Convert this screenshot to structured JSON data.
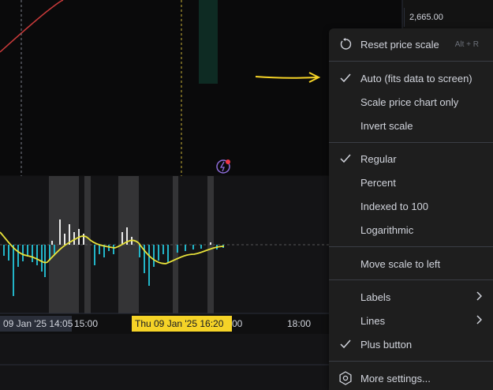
{
  "price_axis": {
    "label": "2,665.00"
  },
  "time_axis": {
    "crosshair_left": "09 Jan '25   14:05",
    "crosshair_right": "Thu 09 Jan '25   16:20",
    "ticks": [
      "15:00",
      "00",
      "18:00"
    ]
  },
  "chart_icon": "lightning-alert-icon",
  "menu": {
    "reset": {
      "label": "Reset price scale",
      "shortcut": "Alt + R",
      "icon": "reset-arrow-icon"
    },
    "auto": {
      "label": "Auto (fits data to screen)",
      "checked": true
    },
    "scale_price_only": {
      "label": "Scale price chart only"
    },
    "invert": {
      "label": "Invert scale"
    },
    "regular": {
      "label": "Regular",
      "checked": true
    },
    "percent": {
      "label": "Percent"
    },
    "indexed": {
      "label": "Indexed to 100"
    },
    "log": {
      "label": "Logarithmic"
    },
    "move_left": {
      "label": "Move scale to left"
    },
    "labels": {
      "label": "Labels"
    },
    "lines": {
      "label": "Lines"
    },
    "plus": {
      "label": "Plus button",
      "checked": true
    },
    "more": {
      "label": "More settings...",
      "icon": "gear-icon"
    }
  },
  "colors": {
    "accent_yellow": "#f5d327",
    "histogram": "#22b5c8",
    "ma_line": "#e8e23a",
    "price_line": "#c83a3a"
  }
}
